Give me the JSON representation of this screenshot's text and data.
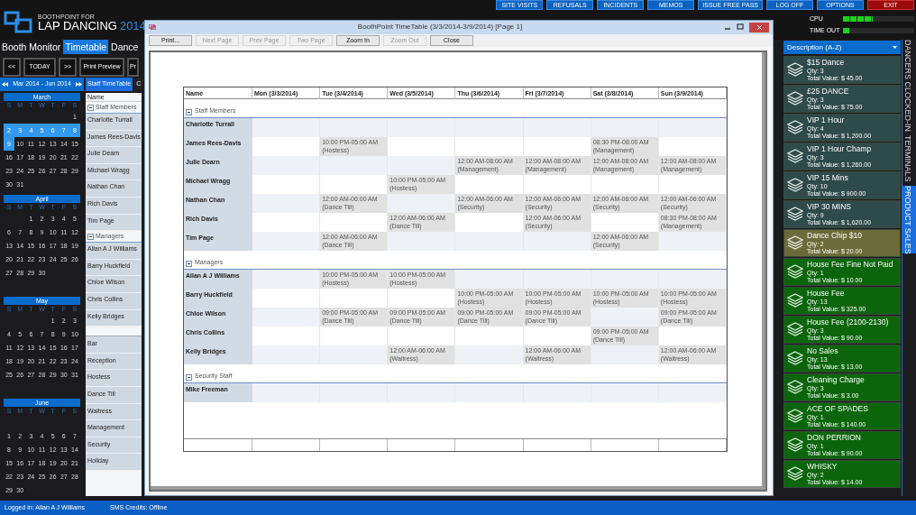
{
  "app": {
    "brand_small": "BOOTHPOINT FOR",
    "brand": "LAP DANCING",
    "brand_year": "2014"
  },
  "top_buttons": [
    {
      "label": "SITE VISITS",
      "kind": "normal"
    },
    {
      "label": "REFUSALS",
      "kind": "normal"
    },
    {
      "label": "INCIDENTS",
      "kind": "normal"
    },
    {
      "label": "MEMOS",
      "kind": "normal"
    },
    {
      "label": "ISSUE FREE PASS",
      "kind": "normal"
    },
    {
      "label": "LOG OFF",
      "kind": "normal"
    },
    {
      "label": "OPTIONS",
      "kind": "normal"
    },
    {
      "label": "EXIT",
      "kind": "danger"
    }
  ],
  "meters": [
    {
      "label": "CPU",
      "level": 0.42
    },
    {
      "label": "TIME OUT",
      "level": 0.09
    }
  ],
  "tabs": [
    {
      "label": "Booth Monitor",
      "selected": false
    },
    {
      "label": "Timetable",
      "selected": true
    },
    {
      "label": "Dance",
      "selected": false
    }
  ],
  "toolbar": [
    "<<",
    "TODAY",
    ">>",
    "Print Preview",
    "Pr"
  ],
  "calendar": {
    "range": "Mar 2014 - Jun 2014",
    "months": [
      {
        "name": "March",
        "weekdays": [
          "S",
          "M",
          "T",
          "W",
          "T",
          "F",
          "S"
        ],
        "days": [
          {
            "kind": "blank"
          },
          {
            "kind": "blank"
          },
          {
            "kind": "blank"
          },
          {
            "kind": "blank"
          },
          {
            "kind": "blank"
          },
          {
            "kind": "blank"
          },
          {
            "kind": "day",
            "day": "1",
            "selected": false
          },
          {
            "kind": "day",
            "day": "2",
            "selected": true
          },
          {
            "kind": "day",
            "day": "3",
            "selected": true
          },
          {
            "kind": "day",
            "day": "4",
            "selected": true
          },
          {
            "kind": "day",
            "day": "5",
            "selected": true
          },
          {
            "kind": "day",
            "day": "6",
            "selected": true
          },
          {
            "kind": "day",
            "day": "7",
            "selected": true
          },
          {
            "kind": "day",
            "day": "8",
            "selected": true
          },
          {
            "kind": "day",
            "day": "9",
            "selected": true
          },
          {
            "kind": "day",
            "day": "10",
            "selected": false
          },
          {
            "kind": "day",
            "day": "11",
            "selected": false
          },
          {
            "kind": "day",
            "day": "12",
            "selected": false
          },
          {
            "kind": "day",
            "day": "13",
            "selected": false
          },
          {
            "kind": "day",
            "day": "14",
            "selected": false
          },
          {
            "kind": "day",
            "day": "15",
            "selected": false
          },
          {
            "kind": "day",
            "day": "16",
            "selected": false
          },
          {
            "kind": "day",
            "day": "17",
            "selected": false
          },
          {
            "kind": "day",
            "day": "18",
            "selected": false
          },
          {
            "kind": "day",
            "day": "19",
            "selected": false
          },
          {
            "kind": "day",
            "day": "20",
            "selected": false
          },
          {
            "kind": "day",
            "day": "21",
            "selected": false
          },
          {
            "kind": "day",
            "day": "22",
            "selected": false
          },
          {
            "kind": "day",
            "day": "23",
            "selected": false
          },
          {
            "kind": "day",
            "day": "24",
            "selected": false
          },
          {
            "kind": "day",
            "day": "25",
            "selected": false
          },
          {
            "kind": "day",
            "day": "26",
            "selected": false
          },
          {
            "kind": "day",
            "day": "27",
            "selected": false
          },
          {
            "kind": "day",
            "day": "28",
            "selected": false
          },
          {
            "kind": "day",
            "day": "29",
            "selected": false
          },
          {
            "kind": "day",
            "day": "30",
            "selected": false
          },
          {
            "kind": "day",
            "day": "31",
            "selected": false
          }
        ]
      },
      {
        "name": "April",
        "weekdays": [
          "S",
          "M",
          "T",
          "W",
          "T",
          "F",
          "S"
        ],
        "days": [
          {
            "kind": "blank"
          },
          {
            "kind": "blank"
          },
          {
            "kind": "day",
            "day": "1",
            "selected": false
          },
          {
            "kind": "day",
            "day": "2",
            "selected": false
          },
          {
            "kind": "day",
            "day": "3",
            "selected": false
          },
          {
            "kind": "day",
            "day": "4",
            "selected": false
          },
          {
            "kind": "day",
            "day": "5",
            "selected": false
          },
          {
            "kind": "day",
            "day": "6",
            "selected": false
          },
          {
            "kind": "day",
            "day": "7",
            "selected": false
          },
          {
            "kind": "day",
            "day": "8",
            "selected": false
          },
          {
            "kind": "day",
            "day": "9",
            "selected": false
          },
          {
            "kind": "day",
            "day": "10",
            "selected": false
          },
          {
            "kind": "day",
            "day": "11",
            "selected": false
          },
          {
            "kind": "day",
            "day": "12",
            "selected": false
          },
          {
            "kind": "day",
            "day": "13",
            "selected": false
          },
          {
            "kind": "day",
            "day": "14",
            "selected": false
          },
          {
            "kind": "day",
            "day": "15",
            "selected": false
          },
          {
            "kind": "day",
            "day": "16",
            "selected": false
          },
          {
            "kind": "day",
            "day": "17",
            "selected": false
          },
          {
            "kind": "day",
            "day": "18",
            "selected": false
          },
          {
            "kind": "day",
            "day": "19",
            "selected": false
          },
          {
            "kind": "day",
            "day": "20",
            "selected": false
          },
          {
            "kind": "day",
            "day": "21",
            "selected": false
          },
          {
            "kind": "day",
            "day": "22",
            "selected": false
          },
          {
            "kind": "day",
            "day": "23",
            "selected": false
          },
          {
            "kind": "day",
            "day": "24",
            "selected": false
          },
          {
            "kind": "day",
            "day": "25",
            "selected": false
          },
          {
            "kind": "day",
            "day": "26",
            "selected": false
          },
          {
            "kind": "day",
            "day": "27",
            "selected": false
          },
          {
            "kind": "day",
            "day": "28",
            "selected": false
          },
          {
            "kind": "day",
            "day": "29",
            "selected": false
          },
          {
            "kind": "day",
            "day": "30",
            "selected": false
          }
        ]
      },
      {
        "name": "May",
        "weekdays": [
          "S",
          "M",
          "T",
          "W",
          "T",
          "F",
          "S"
        ],
        "days": [
          {
            "kind": "blank"
          },
          {
            "kind": "blank"
          },
          {
            "kind": "blank"
          },
          {
            "kind": "blank"
          },
          {
            "kind": "day",
            "day": "1",
            "selected": false
          },
          {
            "kind": "day",
            "day": "2",
            "selected": false
          },
          {
            "kind": "day",
            "day": "3",
            "selected": false
          },
          {
            "kind": "day",
            "day": "4",
            "selected": false
          },
          {
            "kind": "day",
            "day": "5",
            "selected": false
          },
          {
            "kind": "day",
            "day": "6",
            "selected": false
          },
          {
            "kind": "day",
            "day": "7",
            "selected": false
          },
          {
            "kind": "day",
            "day": "8",
            "selected": false
          },
          {
            "kind": "day",
            "day": "9",
            "selected": false
          },
          {
            "kind": "day",
            "day": "10",
            "selected": false
          },
          {
            "kind": "day",
            "day": "11",
            "selected": false
          },
          {
            "kind": "day",
            "day": "12",
            "selected": false
          },
          {
            "kind": "day",
            "day": "13",
            "selected": false
          },
          {
            "kind": "day",
            "day": "14",
            "selected": false
          },
          {
            "kind": "day",
            "day": "15",
            "selected": false
          },
          {
            "kind": "day",
            "day": "16",
            "selected": false
          },
          {
            "kind": "day",
            "day": "17",
            "selected": false
          },
          {
            "kind": "day",
            "day": "18",
            "selected": false
          },
          {
            "kind": "day",
            "day": "19",
            "selected": false
          },
          {
            "kind": "day",
            "day": "20",
            "selected": false
          },
          {
            "kind": "day",
            "day": "21",
            "selected": false
          },
          {
            "kind": "day",
            "day": "22",
            "selected": false
          },
          {
            "kind": "day",
            "day": "23",
            "selected": false
          },
          {
            "kind": "day",
            "day": "24",
            "selected": false
          },
          {
            "kind": "day",
            "day": "25",
            "selected": false
          },
          {
            "kind": "day",
            "day": "26",
            "selected": false
          },
          {
            "kind": "day",
            "day": "27",
            "selected": false
          },
          {
            "kind": "day",
            "day": "28",
            "selected": false
          },
          {
            "kind": "day",
            "day": "29",
            "selected": false
          },
          {
            "kind": "day",
            "day": "30",
            "selected": false
          },
          {
            "kind": "day",
            "day": "31",
            "selected": false
          }
        ]
      },
      {
        "name": "June",
        "weekdays": [
          "S",
          "M",
          "T",
          "W",
          "T",
          "F",
          "S"
        ],
        "days": [
          {
            "kind": "blank"
          },
          {
            "kind": "blank"
          },
          {
            "kind": "blank"
          },
          {
            "kind": "blank"
          },
          {
            "kind": "blank"
          },
          {
            "kind": "blank"
          },
          {
            "kind": "blank"
          },
          {
            "kind": "day",
            "day": "1",
            "selected": false
          },
          {
            "kind": "day",
            "day": "2",
            "selected": false
          },
          {
            "kind": "day",
            "day": "3",
            "selected": false
          },
          {
            "kind": "day",
            "day": "4",
            "selected": false
          },
          {
            "kind": "day",
            "day": "5",
            "selected": false
          },
          {
            "kind": "day",
            "day": "6",
            "selected": false
          },
          {
            "kind": "day",
            "day": "7",
            "selected": false
          },
          {
            "kind": "day",
            "day": "8",
            "selected": false
          },
          {
            "kind": "day",
            "day": "9",
            "selected": false
          },
          {
            "kind": "day",
            "day": "10",
            "selected": false
          },
          {
            "kind": "day",
            "day": "11",
            "selected": false
          },
          {
            "kind": "day",
            "day": "12",
            "selected": false
          },
          {
            "kind": "day",
            "day": "13",
            "selected": false
          },
          {
            "kind": "day",
            "day": "14",
            "selected": false
          },
          {
            "kind": "day",
            "day": "15",
            "selected": false
          },
          {
            "kind": "day",
            "day": "16",
            "selected": false
          },
          {
            "kind": "day",
            "day": "17",
            "selected": false
          },
          {
            "kind": "day",
            "day": "18",
            "selected": false
          },
          {
            "kind": "day",
            "day": "19",
            "selected": false
          },
          {
            "kind": "day",
            "day": "20",
            "selected": false
          },
          {
            "kind": "day",
            "day": "21",
            "selected": false
          },
          {
            "kind": "day",
            "day": "22",
            "selected": false
          },
          {
            "kind": "day",
            "day": "23",
            "selected": false
          },
          {
            "kind": "day",
            "day": "24",
            "selected": false
          },
          {
            "kind": "day",
            "day": "25",
            "selected": false
          },
          {
            "kind": "day",
            "day": "26",
            "selected": false
          },
          {
            "kind": "day",
            "day": "27",
            "selected": false
          },
          {
            "kind": "day",
            "day": "28",
            "selected": false
          },
          {
            "kind": "day",
            "day": "29",
            "selected": false
          },
          {
            "kind": "day",
            "day": "30",
            "selected": false
          }
        ]
      }
    ]
  },
  "view_tabs": [
    {
      "label": "Staff TimeTable",
      "selected": true
    },
    {
      "label": "C",
      "selected": false
    }
  ],
  "staff_list": {
    "header": "Name",
    "groups": [
      {
        "label": "Staff Members",
        "names": [
          "Charlotte Turrall",
          "James Rees-Davis",
          "Julie Dearn",
          "Michael Wragg",
          "Nathan Chan",
          "Rich Davis",
          "Tim Page"
        ]
      },
      {
        "label": "Managers",
        "names": [
          "Allan A J Williams",
          "Barry Huckfield",
          "Chloe Wilson",
          "Chris Collins",
          "Kelly Bridges"
        ]
      }
    ],
    "roles": [
      "Bar",
      "Reception",
      "Hostess",
      "Dance Till",
      "Waitress",
      "Management",
      "Security",
      "Holiday"
    ]
  },
  "preview": {
    "title": "BoothPoint TimeTable (3/3/2014-3/9/2014) [Page 1]",
    "buttons": [
      {
        "label": "Print...",
        "disabled": false
      },
      {
        "label": "Next Page",
        "disabled": true
      },
      {
        "label": "Prev Page",
        "disabled": true
      },
      {
        "label": "Two Page",
        "disabled": true
      },
      {
        "label": "Zoom In",
        "disabled": false
      },
      {
        "label": "Zoom Out",
        "disabled": true
      },
      {
        "label": "Close",
        "disabled": false
      }
    ],
    "table": {
      "columns": [
        "Name",
        "Mon (3/3/2014)",
        "Tue (3/4/2014)",
        "Wed (3/5/2014)",
        "Thu (3/6/2014)",
        "Fri (3/7/2014)",
        "Sat (3/8/2014)",
        "Sun (3/9/2014)"
      ],
      "groups": [
        {
          "label": "Staff Members",
          "rows": [
            {
              "name": "Charlotte Turrall",
              "shifts": [
                {
                  "kind": "off"
                },
                {
                  "kind": "off"
                },
                {
                  "kind": "off"
                },
                {
                  "kind": "off"
                },
                {
                  "kind": "off"
                },
                {
                  "kind": "off"
                },
                {
                  "kind": "off"
                }
              ]
            },
            {
              "name": "James Rees-Davis",
              "shifts": [
                {
                  "kind": "off"
                },
                {
                  "kind": "shift",
                  "time": "10:00 PM-05:00 AM",
                  "role": "(Hostess)"
                },
                {
                  "kind": "off"
                },
                {
                  "kind": "off"
                },
                {
                  "kind": "off"
                },
                {
                  "kind": "shift",
                  "time": "08:30 PM-08:00 AM",
                  "role": "(Management)"
                },
                {
                  "kind": "off"
                }
              ]
            },
            {
              "name": "Julie Dearn",
              "shifts": [
                {
                  "kind": "off"
                },
                {
                  "kind": "off"
                },
                {
                  "kind": "off"
                },
                {
                  "kind": "shift",
                  "time": "12:00 AM-08:00 AM",
                  "role": "(Management)"
                },
                {
                  "kind": "shift",
                  "time": "12:00 AM-08:00 AM",
                  "role": "(Management)"
                },
                {
                  "kind": "shift",
                  "time": "12:00 AM-08:00 AM",
                  "role": "(Management)"
                },
                {
                  "kind": "shift",
                  "time": "12:00 AM-08:00 AM",
                  "role": "(Management)"
                }
              ]
            },
            {
              "name": "Michael Wragg",
              "shifts": [
                {
                  "kind": "off"
                },
                {
                  "kind": "off"
                },
                {
                  "kind": "shift",
                  "time": "10:00 PM-05:00 AM",
                  "role": "(Hostess)"
                },
                {
                  "kind": "off"
                },
                {
                  "kind": "off"
                },
                {
                  "kind": "off"
                },
                {
                  "kind": "off"
                }
              ]
            },
            {
              "name": "Nathan Chan",
              "shifts": [
                {
                  "kind": "off"
                },
                {
                  "kind": "shift",
                  "time": "12:00 AM-06:00 AM",
                  "role": "(Dance Till)"
                },
                {
                  "kind": "off"
                },
                {
                  "kind": "shift",
                  "time": "12:00 AM-06:00 AM",
                  "role": "(Security)"
                },
                {
                  "kind": "shift",
                  "time": "12:00 AM-06:00 AM",
                  "role": "(Security)"
                },
                {
                  "kind": "shift",
                  "time": "12:00 AM-06:00 AM",
                  "role": "(Security)"
                },
                {
                  "kind": "shift",
                  "time": "12:00 AM-06:00 AM",
                  "role": "(Security)"
                }
              ]
            },
            {
              "name": "Rich Davis",
              "shifts": [
                {
                  "kind": "off"
                },
                {
                  "kind": "off"
                },
                {
                  "kind": "shift",
                  "time": "12:00 AM-06:00 AM",
                  "role": "(Dance Till)"
                },
                {
                  "kind": "off"
                },
                {
                  "kind": "shift",
                  "time": "12:00 AM-06:00 AM",
                  "role": "(Security)"
                },
                {
                  "kind": "off"
                },
                {
                  "kind": "shift",
                  "time": "08:30 PM-08:00 AM",
                  "role": "(Management)"
                }
              ]
            },
            {
              "name": "Tim Page",
              "shifts": [
                {
                  "kind": "off"
                },
                {
                  "kind": "shift",
                  "time": "12:00 AM-06:00 AM",
                  "role": "(Dance Till)"
                },
                {
                  "kind": "off"
                },
                {
                  "kind": "off"
                },
                {
                  "kind": "off"
                },
                {
                  "kind": "shift",
                  "time": "12:00 AM-06:00 AM",
                  "role": "(Security)"
                },
                {
                  "kind": "off"
                }
              ]
            }
          ]
        },
        {
          "label": "Managers",
          "rows": [
            {
              "name": "Allan A J Williams",
              "shifts": [
                {
                  "kind": "off"
                },
                {
                  "kind": "shift",
                  "time": "10:00 PM-05:00 AM",
                  "role": "(Hostess)"
                },
                {
                  "kind": "shift",
                  "time": "10:00 PM-05:00 AM",
                  "role": "(Hostess)"
                },
                {
                  "kind": "off"
                },
                {
                  "kind": "off"
                },
                {
                  "kind": "off"
                },
                {
                  "kind": "off"
                }
              ]
            },
            {
              "name": "Barry Huckfield",
              "shifts": [
                {
                  "kind": "off"
                },
                {
                  "kind": "off"
                },
                {
                  "kind": "off"
                },
                {
                  "kind": "shift",
                  "time": "10:00 PM-05:00 AM",
                  "role": "(Hostess)"
                },
                {
                  "kind": "shift",
                  "time": "10:00 PM-05:00 AM",
                  "role": "(Hostess)"
                },
                {
                  "kind": "shift",
                  "time": "10:00 PM-05:00 AM",
                  "role": "(Hostess)"
                },
                {
                  "kind": "shift",
                  "time": "10:00 PM-05:00 AM",
                  "role": "(Hostess)"
                }
              ]
            },
            {
              "name": "Chloe Wilson",
              "shifts": [
                {
                  "kind": "off"
                },
                {
                  "kind": "shift",
                  "time": "09:00 PM-05:00 AM",
                  "role": "(Dance Till)"
                },
                {
                  "kind": "shift",
                  "time": "09:00 PM-05:00 AM",
                  "role": "(Dance Till)"
                },
                {
                  "kind": "shift",
                  "time": "09:00 PM-05:00 AM",
                  "role": "(Dance Till)"
                },
                {
                  "kind": "shift",
                  "time": "09:00 PM-05:00 AM",
                  "role": "(Dance Till)"
                },
                {
                  "kind": "off"
                },
                {
                  "kind": "shift",
                  "time": "09:00 PM-05:00 AM",
                  "role": "(Dance Till)"
                }
              ]
            },
            {
              "name": "Chris Collins",
              "shifts": [
                {
                  "kind": "off"
                },
                {
                  "kind": "off"
                },
                {
                  "kind": "off"
                },
                {
                  "kind": "off"
                },
                {
                  "kind": "off"
                },
                {
                  "kind": "shift",
                  "time": "09:00 PM-05:00 AM",
                  "role": "(Dance Till)"
                },
                {
                  "kind": "off"
                }
              ]
            },
            {
              "name": "Kelly Bridges",
              "shifts": [
                {
                  "kind": "off"
                },
                {
                  "kind": "off"
                },
                {
                  "kind": "shift",
                  "time": "12:00 AM-06:00 AM",
                  "role": "(Waitress)"
                },
                {
                  "kind": "off"
                },
                {
                  "kind": "shift",
                  "time": "12:00 AM-06:00 AM",
                  "role": "(Waitress)"
                },
                {
                  "kind": "off"
                },
                {
                  "kind": "shift",
                  "time": "12:00 AM-06:00 AM",
                  "role": "(Waitress)"
                }
              ]
            }
          ]
        },
        {
          "label": "Security Staff",
          "rows": [
            {
              "name": "Mike Freeman",
              "shifts": [
                {
                  "kind": "off"
                },
                {
                  "kind": "off"
                },
                {
                  "kind": "off"
                },
                {
                  "kind": "off"
                },
                {
                  "kind": "off"
                },
                {
                  "kind": "off"
                },
                {
                  "kind": "off"
                }
              ]
            }
          ]
        }
      ]
    }
  },
  "product_sales": {
    "sort": "Description (A-Z)",
    "items": [
      {
        "name": "$15 Dance",
        "qty": "Qty: 3",
        "total": "Total Value: $ 45.00",
        "color": "#2f4a4a"
      },
      {
        "name": "£25 DANCE",
        "qty": "Qty: 3",
        "total": "Total Value: $ 75.00",
        "color": "#2f4a4a"
      },
      {
        "name": "VIP 1 Hour",
        "qty": "Qty: 4",
        "total": "Total Value: $ 1,200.00",
        "color": "#2f4a4a"
      },
      {
        "name": "VIP 1 Hour Champ",
        "qty": "Qty: 3",
        "total": "Total Value: $ 1,260.00",
        "color": "#2f4a4a"
      },
      {
        "name": "VIP 15 Mins",
        "qty": "Qty: 10",
        "total": "Total Value: $ 900.00",
        "color": "#2f4a4a"
      },
      {
        "name": "VIP 30 MINS",
        "qty": "Qty: 9",
        "total": "Total Value: $ 1,620.00",
        "color": "#2f4a4a"
      },
      {
        "name": "Dance Chip $10",
        "qty": "Qty: 2",
        "total": "Total Value: $ 20.00",
        "color": "#6b6b3a"
      },
      {
        "name": "House Fee Fine Not Paid",
        "qty": "Qty: 1",
        "total": "Total Value: $ 10.00",
        "color": "#0b660b"
      },
      {
        "name": "House Fee",
        "qty": "Qty: 13",
        "total": "Total Value: $ 325.00",
        "color": "#0b660b"
      },
      {
        "name": "House Fee (2100-2130)",
        "qty": "Qty: 3",
        "total": "Total Value: $ 90.00",
        "color": "#0b660b"
      },
      {
        "name": "No Sales",
        "qty": "Qty: 13",
        "total": "Total Value: $ 13.00",
        "color": "#0b660b"
      },
      {
        "name": "Cleaning Charge",
        "qty": "Qty: 3",
        "total": "Total Value: $ 3.00",
        "color": "#0b660b"
      },
      {
        "name": "ACE OF SPADES",
        "qty": "Qty: 1",
        "total": "Total Value: $ 140.00",
        "color": "#0b660b"
      },
      {
        "name": "DON PERRION",
        "qty": "Qty: 1",
        "total": "Total Value: $ 90.00",
        "color": "#0b660b"
      },
      {
        "name": "WHISKY",
        "qty": "Qty: 2",
        "total": "Total Value: $ 14.00",
        "color": "#0b660b"
      }
    ]
  },
  "side_tabs": [
    {
      "label": "DANCERS CLOCKED-IN",
      "selected": false
    },
    {
      "label": "TERMINALS",
      "selected": false
    },
    {
      "label": "PRODUCT SALES",
      "selected": true
    }
  ],
  "status_bar": {
    "user": "Logged in: Allan A J Williams",
    "sms": "SMS Credits: Offline"
  }
}
